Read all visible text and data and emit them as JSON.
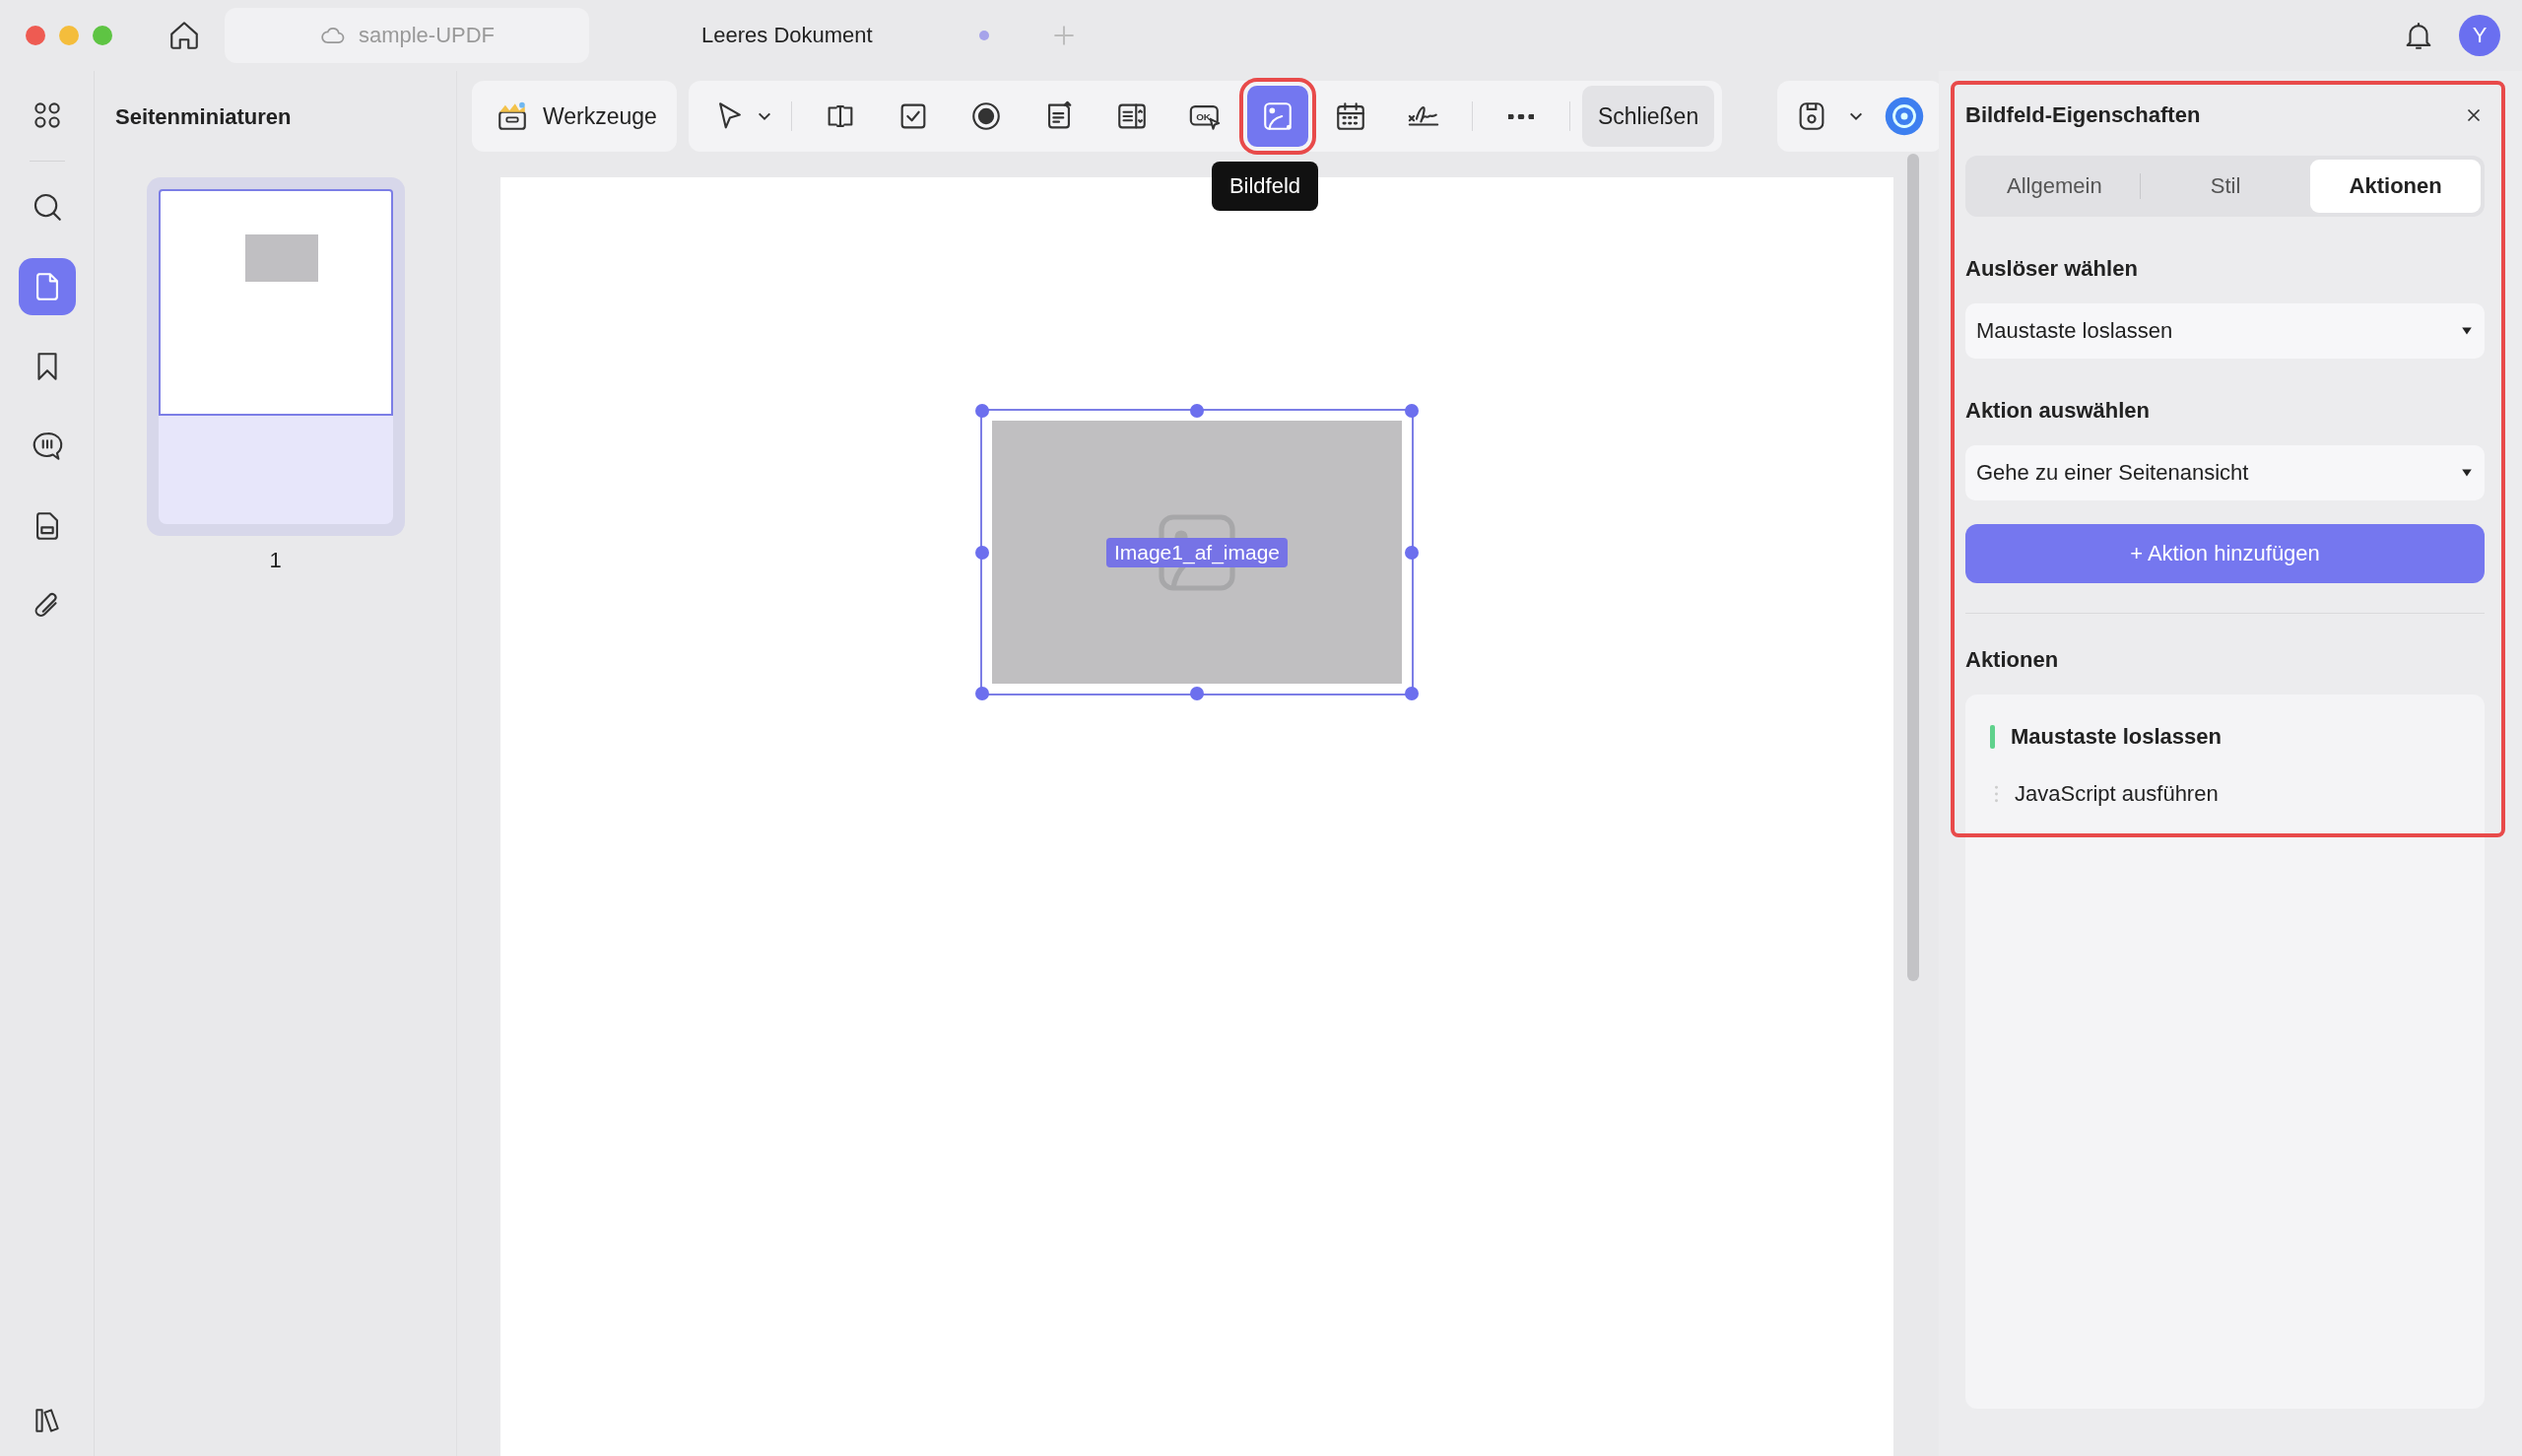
{
  "window": {
    "tabs": [
      {
        "label": "sample-UPDF",
        "kind": "cloud",
        "selected": false,
        "unsaved": false
      },
      {
        "label": "Leeres Dokument",
        "kind": "doc",
        "selected": true,
        "unsaved": true
      }
    ],
    "avatar": "Y"
  },
  "rail": [
    {
      "kind": "grid",
      "selected": false
    },
    {
      "kind": "search",
      "selected": false
    },
    {
      "kind": "pages",
      "selected": true
    },
    {
      "kind": "bookmark",
      "selected": false
    },
    {
      "kind": "comment",
      "selected": false
    },
    {
      "kind": "form",
      "selected": false
    },
    {
      "kind": "attach",
      "selected": false
    }
  ],
  "thumbnails": {
    "title": "Seitenminiaturen",
    "pages": [
      {
        "number": "1",
        "selected": true
      }
    ]
  },
  "toolbar": {
    "tools_button": "Werkzeuge",
    "tools": [
      {
        "kind": "pointer",
        "selected": false,
        "highlighted": false
      },
      {
        "kind": "textfield",
        "selected": false,
        "highlighted": false
      },
      {
        "kind": "checkbox",
        "selected": false,
        "highlighted": false
      },
      {
        "kind": "radio",
        "selected": false,
        "highlighted": false
      },
      {
        "kind": "listbox",
        "selected": false,
        "highlighted": false
      },
      {
        "kind": "combo",
        "selected": false,
        "highlighted": false
      },
      {
        "kind": "okbutton",
        "glyph": "OK",
        "selected": false,
        "highlighted": false
      },
      {
        "kind": "image",
        "selected": true,
        "highlighted": true
      },
      {
        "kind": "date",
        "selected": false,
        "highlighted": false
      },
      {
        "kind": "signature",
        "selected": false,
        "highlighted": false
      },
      {
        "kind": "more",
        "selected": false,
        "highlighted": false
      }
    ],
    "tooltip": "Bildfeld",
    "close_button": "Schließen"
  },
  "canvas": {
    "field_label": "Image1_af_image"
  },
  "properties": {
    "title": "Bildfeld-Eigenschaften",
    "highlighted": true,
    "tabs": [
      {
        "label": "Allgemein",
        "selected": false
      },
      {
        "label": "Stil",
        "selected": false
      },
      {
        "label": "Aktionen",
        "selected": true
      }
    ],
    "trigger_label": "Auslöser wählen",
    "trigger_value": "Maustaste loslassen",
    "action_label": "Aktion auswählen",
    "action_value": "Gehe zu einer Seitenansicht",
    "add_button": "+ Aktion hinzufügen",
    "actions_title": "Aktionen",
    "actions": [
      {
        "label": "Maustaste loslassen",
        "kind": "trigger"
      },
      {
        "label": "JavaScript ausführen",
        "kind": "action"
      }
    ]
  }
}
